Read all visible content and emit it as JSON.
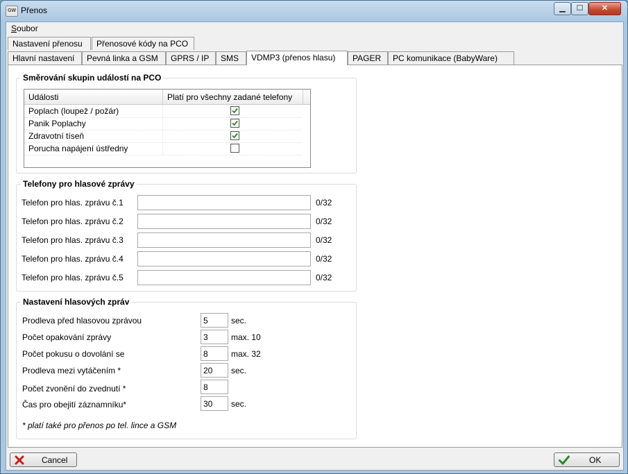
{
  "window": {
    "title": "Přenos",
    "icon_text": "GW",
    "minimize": "▁",
    "maximize": "☐",
    "close": "✕"
  },
  "menu": {
    "soubor_first": "S",
    "soubor_rest": "oubor"
  },
  "tabs_row1": [
    {
      "label": "Nastavení přenosu"
    },
    {
      "label": "Přenosové kódy na PCO"
    }
  ],
  "tabs_row2": [
    {
      "label": "Hlavní nastavení"
    },
    {
      "label": "Pevná linka a GSM"
    },
    {
      "label": "GPRS / IP"
    },
    {
      "label": "SMS"
    },
    {
      "label": "VDMP3 (přenos hlasu)",
      "active": true
    },
    {
      "label": "PAGER"
    },
    {
      "label": "PC komunikace (BabyWare)"
    }
  ],
  "routing": {
    "title": "Směrování skupin událostí na PCO",
    "col_events": "Události",
    "col_all_phones": "Platí pro všechny zadané telefony",
    "rows": [
      {
        "name": "Poplach (loupež / požár)",
        "checked": true
      },
      {
        "name": "Panik Poplachy",
        "checked": true
      },
      {
        "name": "Zdravotní tíseň",
        "checked": true
      },
      {
        "name": "Porucha napájení ústředny",
        "checked": false
      }
    ]
  },
  "phones": {
    "title": "Telefony pro hlasové zprávy",
    "items": [
      {
        "label": "Telefon pro hlas. zprávu č.1",
        "value": "",
        "counter": "0/32"
      },
      {
        "label": "Telefon pro hlas. zprávu č.2",
        "value": "",
        "counter": "0/32"
      },
      {
        "label": "Telefon pro hlas. zprávu č.3",
        "value": "",
        "counter": "0/32"
      },
      {
        "label": "Telefon pro hlas. zprávu č.4",
        "value": "",
        "counter": "0/32"
      },
      {
        "label": "Telefon pro hlas. zprávu č.5",
        "value": "",
        "counter": "0/32"
      }
    ]
  },
  "voice": {
    "title": "Nastavení hlasových zpráv",
    "items": [
      {
        "label": "Prodleva před hlasovou zprávou",
        "value": "5",
        "suffix": "sec."
      },
      {
        "label": "Počet opakování zprávy",
        "value": "3",
        "suffix": "max. 10"
      },
      {
        "label": "Počet pokusu o dovolání se",
        "value": "8",
        "suffix": "max. 32"
      },
      {
        "label": "Prodleva mezi vytáčením *",
        "value": "20",
        "suffix": "sec."
      },
      {
        "label": "Počet zvonění do zvednutí *",
        "value": "8",
        "suffix": ""
      },
      {
        "label": "Čas pro obejití záznamníku*",
        "value": "30",
        "suffix": "sec."
      }
    ],
    "note": "* platí také pro přenos po tel. lince a GSM"
  },
  "buttons": {
    "cancel": "Cancel",
    "ok": "OK"
  },
  "colors": {
    "accent_window": "#aac7e2",
    "check_green": "#2a8a2a",
    "cancel_red": "#cc1a1a"
  }
}
